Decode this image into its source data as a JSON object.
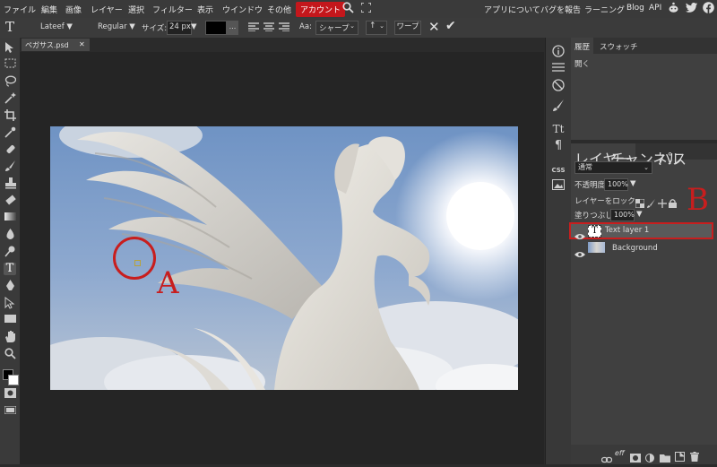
{
  "menubar": {
    "logo_glyph": "🌀",
    "items": [
      "ファイル",
      "編集",
      "画像",
      "レイヤー",
      "選択",
      "フィルター",
      "表示",
      "ウインドウ",
      "その他"
    ],
    "account": "アカウント",
    "right_items": [
      "アプリについて",
      "バグを報告",
      "ラーニング",
      "Blog",
      "API"
    ]
  },
  "options": {
    "tool_glyph": "T",
    "font_family": "Lateef ▼",
    "font_style": "Regular ▼",
    "size_label": "サイズ:",
    "size_value": "24 px",
    "size_arrow": "▼",
    "color_dots": "...",
    "aa_label": "Aa:",
    "aa_value": "シャープ",
    "line_value": "↑",
    "warp_label": "ワープ",
    "cancel_glyph": "✕",
    "commit_glyph": "✔"
  },
  "document": {
    "tab_name": "ペガサス.psd",
    "tab_close": "✕"
  },
  "annotations": {
    "a_label": "A",
    "b_label": "B",
    "color": "#c81e1e"
  },
  "history": {
    "tabs": [
      "履歴",
      "スウォッチ"
    ],
    "items": [
      "開く"
    ]
  },
  "layers_panel": {
    "tabs": [
      "レイヤー",
      "チャンネル",
      "パス"
    ],
    "blend_mode": "通常",
    "opacity_label": "不透明度:",
    "opacity_value": "100%",
    "lock_label": "レイヤーをロック:",
    "fill_label": "塗りつぶし:",
    "fill_value": "100%",
    "layers": [
      {
        "name": "Text layer 1",
        "thumb": "T",
        "selected": true
      },
      {
        "name": "Background",
        "thumb": "",
        "selected": false
      }
    ],
    "footer_icons": [
      "link-icon",
      "effects-icon",
      "mask-icon",
      "adjustment-icon",
      "folder-icon",
      "new-layer-icon",
      "trash-icon"
    ],
    "footer_text": "eff"
  },
  "strip": {
    "css_label": "CSS",
    "text_glyph": "Tt",
    "para_glyph": "¶"
  }
}
